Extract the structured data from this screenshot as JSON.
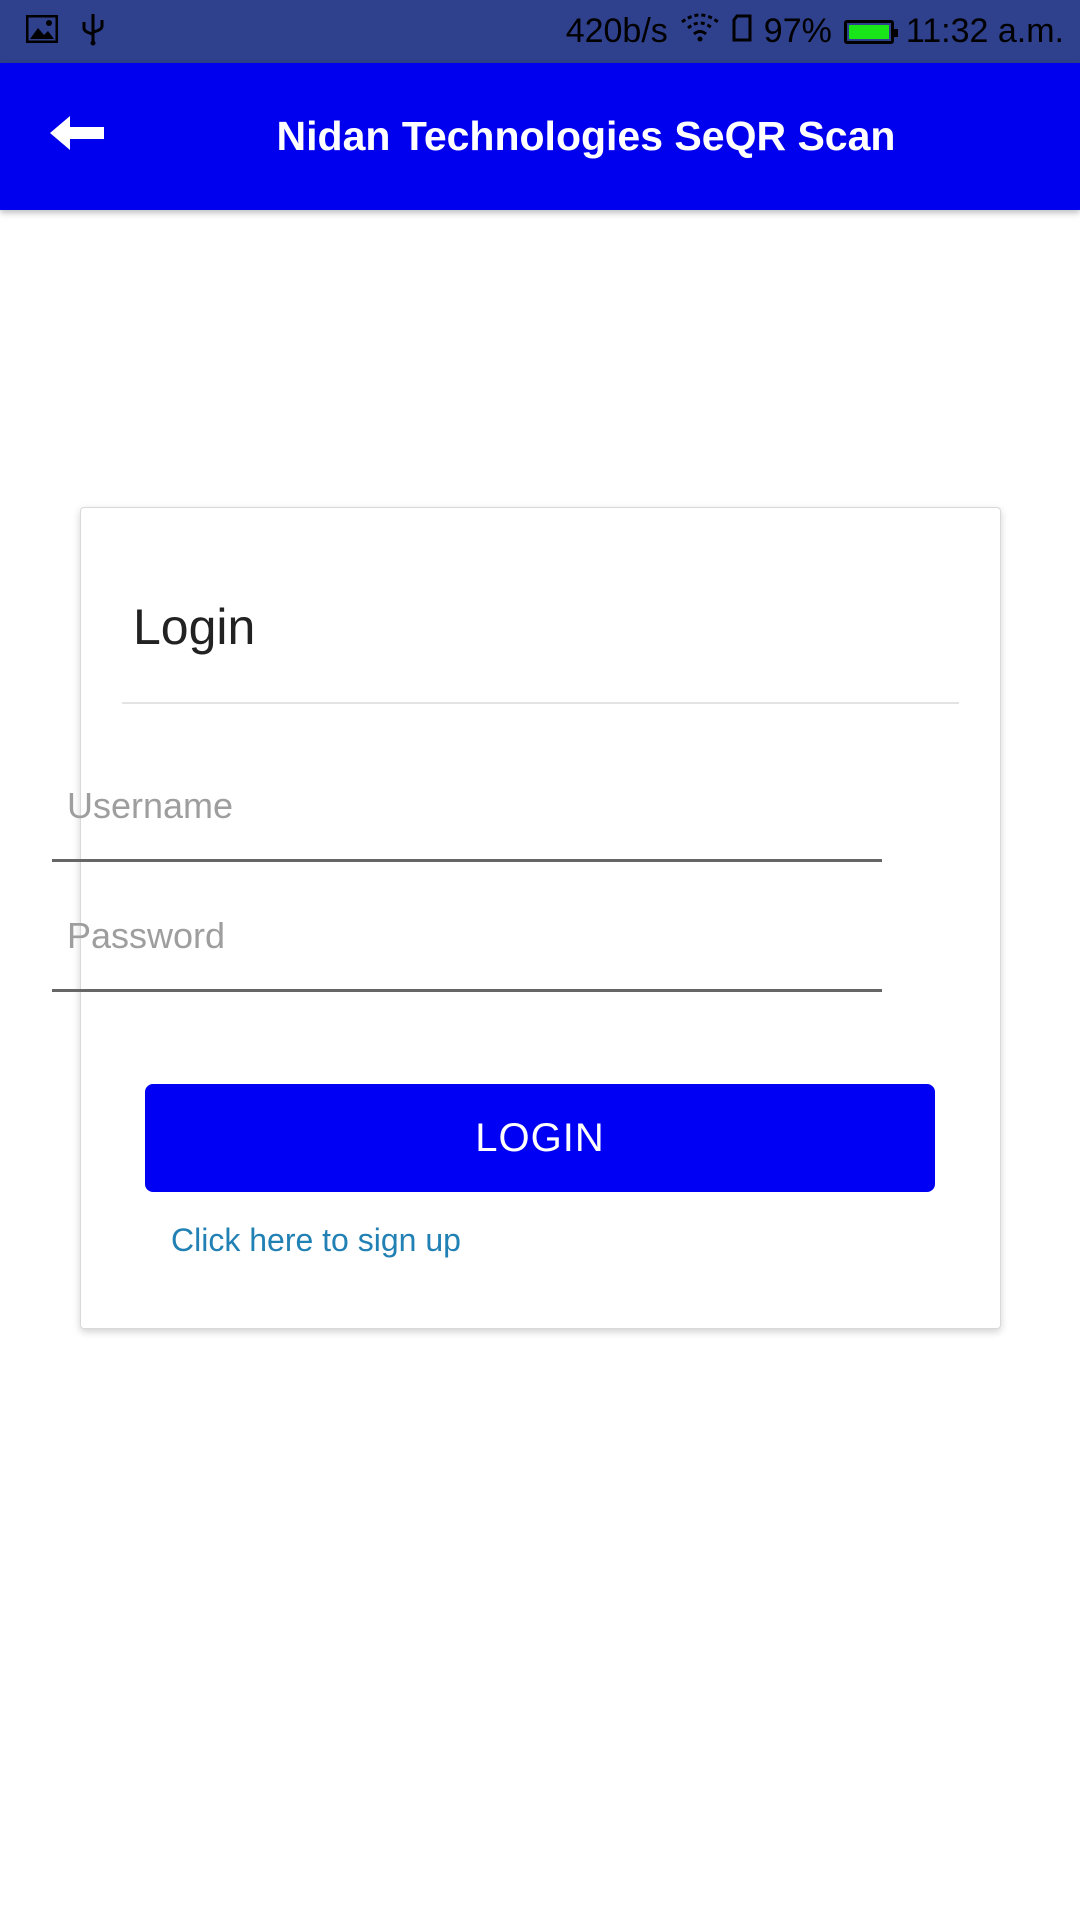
{
  "status_bar": {
    "speed": "420b/s",
    "battery": "97%",
    "time": "11:32 a.m.",
    "colors": {
      "background": "#2f408c",
      "battery_fill": "#19e619"
    },
    "icons": [
      "image-icon",
      "usb-icon",
      "wifi-icon",
      "sim-icon",
      "battery-icon"
    ]
  },
  "app_bar": {
    "title": "Nidan Technologies SeQR Scan",
    "back_icon": "back-arrow-icon",
    "color": "#0000ee"
  },
  "login_card": {
    "title": "Login",
    "username_placeholder": "Username",
    "username_value": "",
    "password_placeholder": "Password",
    "password_value": "",
    "login_label": "LOGIN",
    "login_color": "#0000f4",
    "signup_label": "Click here to sign up",
    "signup_color": "#2180b4"
  }
}
